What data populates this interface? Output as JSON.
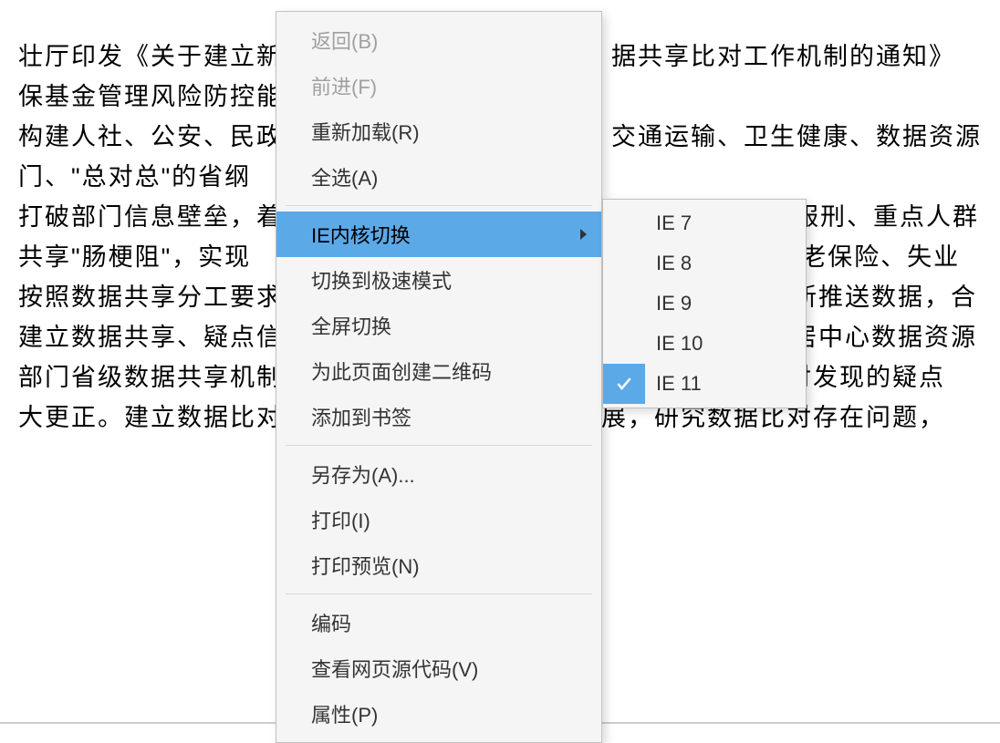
{
  "background": {
    "lines": [
      "壮厅印发《关于建立新",
      "保基金管理风险防控能",
      "构建人社、公安、民政",
      "门、\"总对总\"的省纲",
      "打破部门信息壁垒，着",
      "共享\"肠梗阻\"，实现",
      "按照数据共享分工要求",
      "建立数据共享、疑点信",
      "部门省级数据共享机制",
      "大更正。建立数据比对"
    ],
    "lines_right": [
      "据共享比对工作机制的通知》",
      "",
      "交通运输、卫生健康、数据资源",
      "",
      "服刑、重点人群",
      "养老保险、失业",
      "新推送数据，合",
      "居中心数据资源",
      "对。对通过数据比对发现的疑点",
      "主展，研究数据比对存在问题，"
    ]
  },
  "menu": {
    "back": "返回(B)",
    "forward": "前进(F)",
    "reload": "重新加载(R)",
    "select_all": "全选(A)",
    "ie_kernel_switch": "IE内核切换",
    "switch_fast_mode": "切换到极速模式",
    "fullscreen_switch": "全屏切换",
    "create_qr": "为此页面创建二维码",
    "add_bookmark": "添加到书签",
    "save_as": "另存为(A)...",
    "print": "打印(I)",
    "print_preview": "打印预览(N)",
    "encoding": "编码",
    "view_source": "查看网页源代码(V)",
    "properties": "属性(P)"
  },
  "submenu": {
    "ie7": "IE 7",
    "ie8": "IE 8",
    "ie9": "IE 9",
    "ie10": "IE 10",
    "ie11": "IE 11"
  },
  "red_marker": "】"
}
